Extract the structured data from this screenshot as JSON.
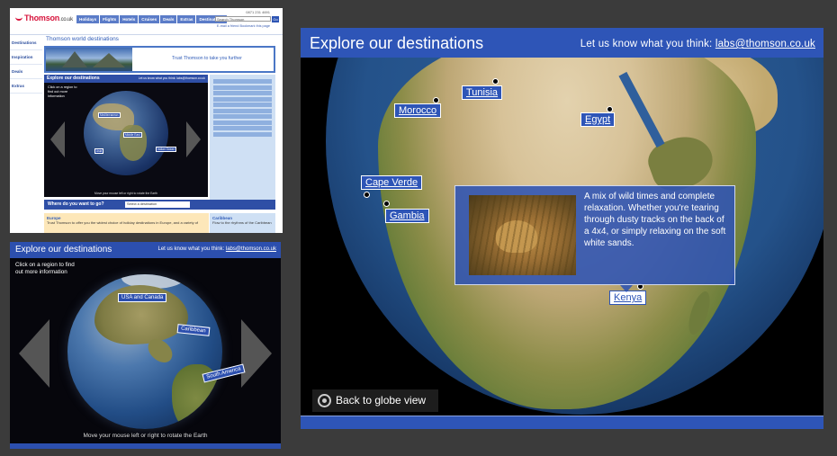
{
  "site": {
    "logo": "Thomson",
    "logo_suffix": ".co.uk",
    "nav": [
      "Holidays",
      "Flights",
      "Hotels",
      "Cruises",
      "Deals",
      "Extras",
      "Destinations"
    ],
    "phone": "0871 231 4691",
    "search_placeholder": "Search Thomson",
    "go_label": "Go",
    "top_links": "E-mail a friend   Bookmark this page",
    "left_nav": [
      "Destinations",
      "Inspiration",
      "Deals",
      "Extras"
    ],
    "page_title": "Thomson world destinations",
    "banner_text": "Trust Thomson to take you further",
    "mini_header_title": "Explore our destinations",
    "mini_header_right": "Let us know what you think: labs@thomson.co.uk",
    "mini_click": "Click on a region to find out more information",
    "mini_labels": [
      "Mediterranean",
      "Middle East",
      "Asia",
      "Indian Ocean"
    ],
    "mini_footer": "Move your mouse left or right to rotate the Earth",
    "where_label": "Where do you want to go?",
    "where_select": "Select a destination",
    "europe_title": "Europe",
    "europe_text": "Trust Thomson to offer you the widest choice of holiday destinations in Europe, and a variety of",
    "carib_title": "Caribbean",
    "carib_text": "Flow to the rhythms of the Caribbean"
  },
  "mid": {
    "title": "Explore our destinations",
    "feedback": "Let us know what you think:",
    "email": "labs@thomson.co.uk",
    "click_text": "Click on a region to find out more information",
    "labels": [
      "USA and Canada",
      "Caribbean",
      "South America"
    ],
    "footer": "Move your mouse left or right to rotate the Earth"
  },
  "main": {
    "title": "Explore our destinations",
    "feedback": "Let us know what you think:",
    "email": "labs@thomson.co.uk",
    "destinations": [
      "Tunisia",
      "Morocco",
      "Egypt",
      "Cape Verde",
      "Gambia",
      "Kenya"
    ],
    "popup_text": "A mix of wild times and complete relaxation. Whether you're tearing through dusty tracks on the back of a 4x4, or simply relaxing on the soft white sands.",
    "back_label": "Back to globe view"
  },
  "colors": {
    "accent": "#2e55b7",
    "background": "#3b3b3b",
    "brand_red": "#d7143c"
  }
}
